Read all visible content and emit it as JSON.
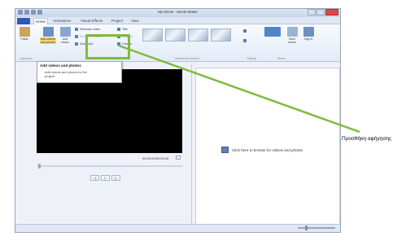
{
  "window": {
    "title": "My Movie - Movie Maker"
  },
  "tabs": [
    "Home",
    "Animations",
    "Visual Effects",
    "Project",
    "View"
  ],
  "ribbon": {
    "paste_label": "Paste",
    "add_videos_label": "Add videos and photos",
    "add_music_label": "Add music",
    "webcam_label": "Webcam video",
    "narration_label": "Record narration",
    "snapshot_label": "Snapshot",
    "title_label": "Title",
    "caption_label": "Caption",
    "credits_label": "Credits",
    "save_movie_label": "Save movie",
    "signin_label": "Sign in",
    "groups": [
      "Clipboard",
      "Add",
      "AutoMovie themes",
      "Editing",
      "Share"
    ]
  },
  "tooltip": {
    "title": "Add videos and photos",
    "description": "Add videos and photos to the project"
  },
  "player": {
    "timecode": "00:00:00/00:00:00",
    "controls": [
      "◁|",
      "▷",
      "|▷"
    ]
  },
  "storyboard": {
    "browse_text": "Click here to browse for videos and photos"
  },
  "annotation": {
    "label": "Προσθήκη αφήγησης",
    "color": "#7dbb3f"
  }
}
